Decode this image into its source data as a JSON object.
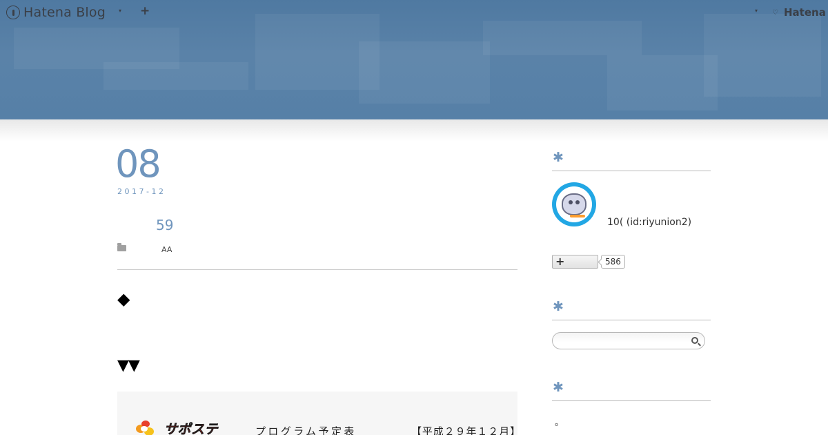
{
  "colors": {
    "header_bg": "#5680a7",
    "accent_blue": "#6f95bd",
    "header_text": "#3a3f47"
  },
  "header": {
    "brand_name": "Hatena Blog",
    "brand_icon": "hatena-blog-logo-icon",
    "menu_caret": "▾",
    "add_label": "+",
    "user_menu_caret": "▾",
    "hatena_mark": "♡",
    "hatena_label": "Hatena"
  },
  "entry": {
    "day": "08",
    "year_month": "2017-12",
    "bookmark_count": "59",
    "category_icon": "folder-icon",
    "category": "AA",
    "diamond": "◆",
    "triangles": "▼▼",
    "flyer": {
      "brand": "サポステ",
      "title": "プログラム予定表",
      "date": "【平成２９年１２月】"
    }
  },
  "sidebar": {
    "section_marker": "✱",
    "profile": {
      "avatar_icon": "mascot-avatar-icon",
      "name": "10(",
      "id_label": "(id:",
      "user_id": "riyunion2)"
    },
    "subscribe": {
      "button_label": "+",
      "count": "586"
    },
    "search": {
      "placeholder": "",
      "icon": "search-icon"
    },
    "about": {
      "text": "。"
    }
  }
}
